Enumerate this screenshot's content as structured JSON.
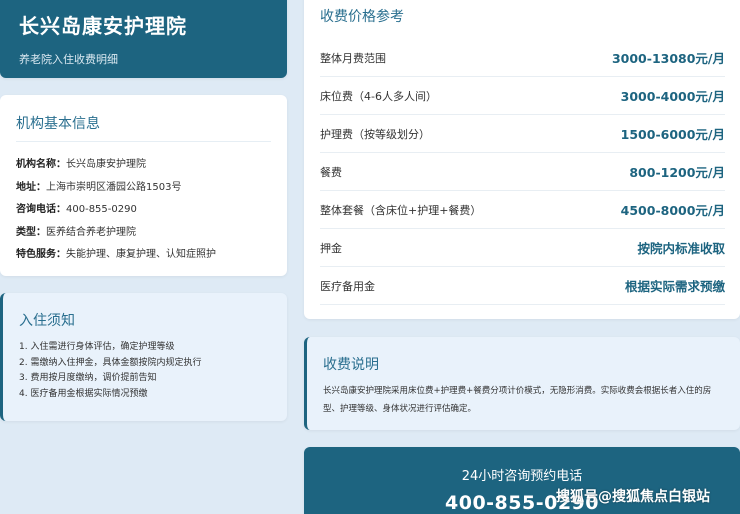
{
  "header": {
    "title": "长兴岛康安护理院",
    "subtitle": "养老院入住收费明细"
  },
  "info": {
    "title": "机构基本信息",
    "rows": [
      {
        "key": "机构名称：",
        "value": "长兴岛康安护理院"
      },
      {
        "key": "地址：",
        "value": "上海市崇明区潘园公路1503号"
      },
      {
        "key": "咨询电话：",
        "value": "400-855-0290"
      },
      {
        "key": "类型：",
        "value": "医养结合养老护理院"
      },
      {
        "key": "特色服务：",
        "value": "失能护理、康复护理、认知症照护"
      }
    ]
  },
  "notice": {
    "title": "入住须知",
    "items": [
      "1. 入住需进行身体评估，确定护理等级",
      "2. 需缴纳入住押金，具体金额按院内规定执行",
      "3. 费用按月度缴纳，调价提前告知",
      "4. 医疗备用金根据实际情况预缴"
    ]
  },
  "fees": {
    "title": "收费价格参考",
    "rows": [
      {
        "label": "整体月费范围",
        "value": "3000-13080元/月"
      },
      {
        "label": "床位费（4-6人多人间）",
        "value": "3000-4000元/月"
      },
      {
        "label": "护理费（按等级划分）",
        "value": "1500-6000元/月"
      },
      {
        "label": "餐费",
        "value": "800-1200元/月"
      },
      {
        "label": "整体套餐（含床位+护理+餐费）",
        "value": "4500-8000元/月"
      },
      {
        "label": "押金",
        "value": "按院内标准收取"
      },
      {
        "label": "医疗备用金",
        "value": "根据实际需求预缴"
      }
    ]
  },
  "fee_note": {
    "title": "收费说明",
    "text": "长兴岛康安护理院采用床位费+护理费+餐费分项计价模式，无隐形消费。实际收费会根据长者入住的房型、护理等级、身体状况进行评估确定。"
  },
  "phone": {
    "title": "24小时咨询预约电话",
    "number": "400-855-0290"
  },
  "watermark": "搜狐号@搜狐焦点白银站",
  "colors": {
    "brand": "#1d6480",
    "accent_text": "#2a6f8f",
    "background": "#deeaf5",
    "light_panel": "#e9f2fb"
  }
}
